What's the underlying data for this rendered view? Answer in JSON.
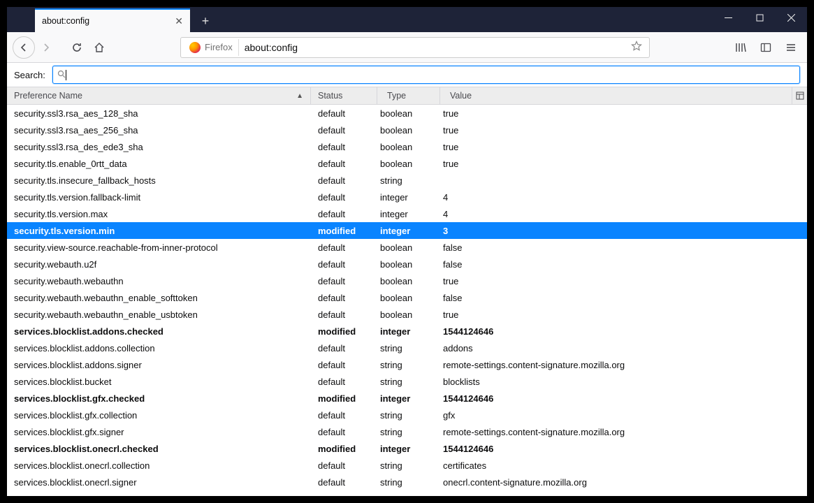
{
  "titlebar": {
    "tab_title": "about:config",
    "new_tab_tooltip": "+"
  },
  "navbar": {
    "identity_label": "Firefox",
    "url": "about:config"
  },
  "search": {
    "label": "Search:",
    "value": ""
  },
  "columns": {
    "pref": "Preference Name",
    "status": "Status",
    "type": "Type",
    "value": "Value"
  },
  "rows": [
    {
      "name": "security.ssl3.rsa_aes_128_sha",
      "status": "default",
      "type": "boolean",
      "value": "true",
      "modified": false,
      "selected": false
    },
    {
      "name": "security.ssl3.rsa_aes_256_sha",
      "status": "default",
      "type": "boolean",
      "value": "true",
      "modified": false,
      "selected": false
    },
    {
      "name": "security.ssl3.rsa_des_ede3_sha",
      "status": "default",
      "type": "boolean",
      "value": "true",
      "modified": false,
      "selected": false
    },
    {
      "name": "security.tls.enable_0rtt_data",
      "status": "default",
      "type": "boolean",
      "value": "true",
      "modified": false,
      "selected": false
    },
    {
      "name": "security.tls.insecure_fallback_hosts",
      "status": "default",
      "type": "string",
      "value": "",
      "modified": false,
      "selected": false
    },
    {
      "name": "security.tls.version.fallback-limit",
      "status": "default",
      "type": "integer",
      "value": "4",
      "modified": false,
      "selected": false
    },
    {
      "name": "security.tls.version.max",
      "status": "default",
      "type": "integer",
      "value": "4",
      "modified": false,
      "selected": false
    },
    {
      "name": "security.tls.version.min",
      "status": "modified",
      "type": "integer",
      "value": "3",
      "modified": true,
      "selected": true
    },
    {
      "name": "security.view-source.reachable-from-inner-protocol",
      "status": "default",
      "type": "boolean",
      "value": "false",
      "modified": false,
      "selected": false
    },
    {
      "name": "security.webauth.u2f",
      "status": "default",
      "type": "boolean",
      "value": "false",
      "modified": false,
      "selected": false
    },
    {
      "name": "security.webauth.webauthn",
      "status": "default",
      "type": "boolean",
      "value": "true",
      "modified": false,
      "selected": false
    },
    {
      "name": "security.webauth.webauthn_enable_softtoken",
      "status": "default",
      "type": "boolean",
      "value": "false",
      "modified": false,
      "selected": false
    },
    {
      "name": "security.webauth.webauthn_enable_usbtoken",
      "status": "default",
      "type": "boolean",
      "value": "true",
      "modified": false,
      "selected": false
    },
    {
      "name": "services.blocklist.addons.checked",
      "status": "modified",
      "type": "integer",
      "value": "1544124646",
      "modified": true,
      "selected": false
    },
    {
      "name": "services.blocklist.addons.collection",
      "status": "default",
      "type": "string",
      "value": "addons",
      "modified": false,
      "selected": false
    },
    {
      "name": "services.blocklist.addons.signer",
      "status": "default",
      "type": "string",
      "value": "remote-settings.content-signature.mozilla.org",
      "modified": false,
      "selected": false
    },
    {
      "name": "services.blocklist.bucket",
      "status": "default",
      "type": "string",
      "value": "blocklists",
      "modified": false,
      "selected": false
    },
    {
      "name": "services.blocklist.gfx.checked",
      "status": "modified",
      "type": "integer",
      "value": "1544124646",
      "modified": true,
      "selected": false
    },
    {
      "name": "services.blocklist.gfx.collection",
      "status": "default",
      "type": "string",
      "value": "gfx",
      "modified": false,
      "selected": false
    },
    {
      "name": "services.blocklist.gfx.signer",
      "status": "default",
      "type": "string",
      "value": "remote-settings.content-signature.mozilla.org",
      "modified": false,
      "selected": false
    },
    {
      "name": "services.blocklist.onecrl.checked",
      "status": "modified",
      "type": "integer",
      "value": "1544124646",
      "modified": true,
      "selected": false
    },
    {
      "name": "services.blocklist.onecrl.collection",
      "status": "default",
      "type": "string",
      "value": "certificates",
      "modified": false,
      "selected": false
    },
    {
      "name": "services.blocklist.onecrl.signer",
      "status": "default",
      "type": "string",
      "value": "onecrl.content-signature.mozilla.org",
      "modified": false,
      "selected": false
    }
  ]
}
